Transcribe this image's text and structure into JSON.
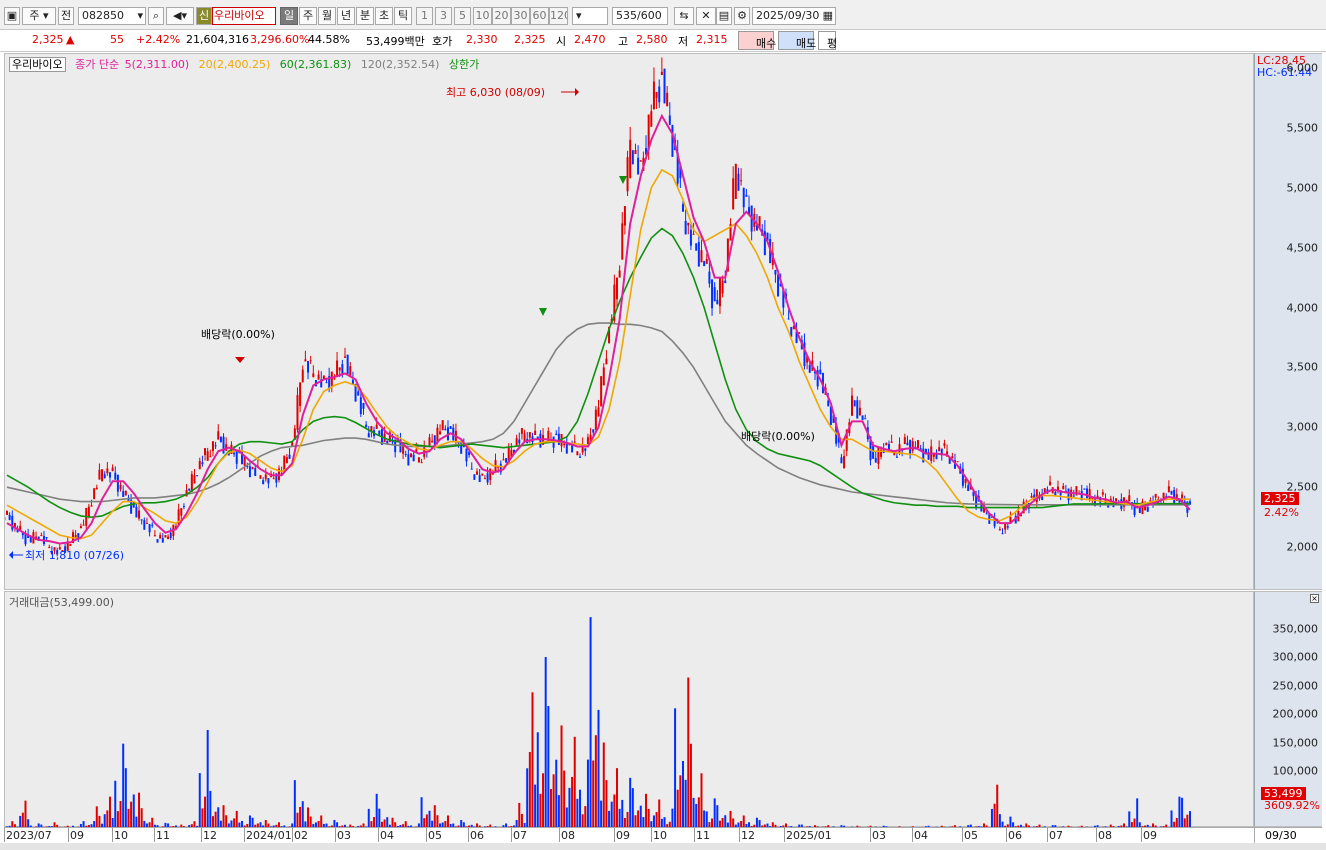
{
  "toolbar": {
    "market": "주",
    "prev": "전",
    "code": "082850",
    "new_badge": "신",
    "stock_name": "우리바이오",
    "periods": [
      "일",
      "주",
      "월",
      "년",
      "분",
      "초",
      "틱"
    ],
    "intervals": [
      "1",
      "3",
      "5",
      "10",
      "20",
      "30",
      "60",
      "120"
    ],
    "count": "535",
    "count_max": "/600",
    "date": "2025/09/30"
  },
  "status": {
    "price": "2,325",
    "arrow": "▲",
    "change": "55",
    "change_pct": "+2.42%",
    "volume": "21,604,316",
    "vol_ratio": "3,296.60%",
    "turnover": "44.58%",
    "amount": "53,499백만",
    "quote_label": "호가",
    "quote_ask": "2,330",
    "quote_bid": "2,325",
    "open_label": "시",
    "open": "2,470",
    "high_label": "고",
    "high": "2,580",
    "low_label": "저",
    "low": "2,315",
    "buy": "매수",
    "sell": "매도",
    "last": "평"
  },
  "price_panel": {
    "legend": {
      "name": "우리바이오",
      "close": "종가 단순",
      "ma5": "5(2,311.00)",
      "ma20": "20(2,400.25)",
      "ma60": "60(2,361.83)",
      "ma120": "120(2,352.54)",
      "limit": "상한가"
    },
    "lc": "LC:28.45",
    "hc": "HC:-61.44",
    "y_ticks": [
      "6,000",
      "5,500",
      "5,000",
      "4,500",
      "4,000",
      "3,500",
      "3,000",
      "2,500",
      "2,000"
    ],
    "current_tag": "2,325",
    "pct_tag": "2.42%",
    "annotations": {
      "high": "최고 6,030 (08/09)",
      "low": "최저 1,810 (07/26)",
      "div1": "배당락(0.00%)",
      "div2": "배당락(0.00%)"
    }
  },
  "volume_panel": {
    "legend": "거래대금(53,499.00)",
    "y_ticks": [
      "350,000",
      "300,000",
      "250,000",
      "200,000",
      "150,000",
      "100,000"
    ],
    "current_tag": "53,499",
    "pct_tag": "3609.92%"
  },
  "x_axis": {
    "labels": [
      "2023/07",
      "09",
      "10",
      "11",
      "12",
      "2024/01",
      "02",
      "03",
      "04",
      "05",
      "06",
      "07",
      "08",
      "09",
      "10",
      "11",
      "12",
      "2025/01",
      "03",
      "04",
      "05",
      "06",
      "07",
      "08",
      "09"
    ],
    "end_label": "09/30"
  },
  "colors": {
    "up": "#e00000",
    "down": "#0030ff",
    "ma5": "#e0209a",
    "ma20": "#f0a800",
    "ma60": "#109010",
    "ma120": "#808080"
  },
  "chart_data": {
    "type": "candlestick",
    "price_y_range": [
      1650,
      6050
    ],
    "x_start_month": "2023/07",
    "closes": [
      2250,
      2150,
      2050,
      2100,
      2000,
      1950,
      2050,
      2150,
      2400,
      2650,
      2600,
      2450,
      2300,
      2200,
      2100,
      2050,
      2200,
      2450,
      2650,
      2800,
      2900,
      2800,
      2750,
      2650,
      2600,
      2550,
      2650,
      2850,
      3550,
      3450,
      3350,
      3450,
      3550,
      3300,
      3000,
      2950,
      2900,
      2850,
      2750,
      2750,
      2850,
      3000,
      2950,
      2850,
      2650,
      2550,
      2650,
      2700,
      2850,
      2950,
      2900,
      2900,
      2900,
      2850,
      2800,
      2850,
      3200,
      3800,
      4400,
      5400,
      5100,
      5700,
      5900,
      5400,
      4800,
      4500,
      4400,
      4000,
      4300,
      5200,
      4800,
      4700,
      4500,
      4200,
      3900,
      3700,
      3500,
      3400,
      3100,
      2700,
      3200,
      3100,
      2700,
      2850,
      2800,
      2850,
      2850,
      2750,
      2800,
      2800,
      2650,
      2500,
      2350,
      2250,
      2150,
      2200,
      2300,
      2400,
      2450,
      2500,
      2450,
      2450,
      2450,
      2400,
      2400,
      2350,
      2400,
      2300,
      2350,
      2400,
      2450,
      2400,
      2325
    ],
    "ma5": [
      2200,
      2150,
      2100,
      2060,
      2050,
      2030,
      2040,
      2080,
      2200,
      2400,
      2550,
      2550,
      2450,
      2320,
      2200,
      2120,
      2150,
      2280,
      2450,
      2650,
      2800,
      2830,
      2800,
      2720,
      2650,
      2600,
      2600,
      2700,
      3100,
      3350,
      3400,
      3420,
      3450,
      3400,
      3200,
      3050,
      2950,
      2900,
      2820,
      2780,
      2800,
      2900,
      2950,
      2900,
      2780,
      2650,
      2620,
      2650,
      2780,
      2880,
      2900,
      2900,
      2890,
      2870,
      2840,
      2840,
      3000,
      3400,
      3900,
      4700,
      5100,
      5400,
      5600,
      5450,
      5100,
      4750,
      4550,
      4250,
      4250,
      4700,
      4800,
      4700,
      4550,
      4300,
      4000,
      3750,
      3550,
      3400,
      3200,
      2850,
      3050,
      3050,
      2850,
      2820,
      2800,
      2820,
      2830,
      2780,
      2780,
      2770,
      2680,
      2550,
      2400,
      2280,
      2200,
      2200,
      2280,
      2370,
      2440,
      2480,
      2460,
      2450,
      2440,
      2410,
      2400,
      2370,
      2380,
      2330,
      2350,
      2380,
      2420,
      2400,
      2311
    ],
    "ma20": [
      2350,
      2300,
      2250,
      2200,
      2150,
      2100,
      2080,
      2070,
      2100,
      2200,
      2300,
      2380,
      2380,
      2330,
      2280,
      2220,
      2200,
      2250,
      2380,
      2540,
      2700,
      2790,
      2810,
      2780,
      2720,
      2660,
      2630,
      2680,
      2900,
      3150,
      3300,
      3350,
      3380,
      3350,
      3250,
      3120,
      3000,
      2920,
      2870,
      2820,
      2810,
      2850,
      2880,
      2880,
      2820,
      2740,
      2680,
      2670,
      2720,
      2800,
      2860,
      2880,
      2880,
      2870,
      2860,
      2850,
      2920,
      3150,
      3550,
      4100,
      4650,
      5000,
      5150,
      5100,
      4900,
      4650,
      4550,
      4600,
      4650,
      4700,
      4600,
      4450,
      4250,
      4000,
      3800,
      3550,
      3350,
      3150,
      3000,
      2900,
      2900,
      2850,
      2800,
      2800,
      2790,
      2780,
      2770,
      2720,
      2640,
      2520,
      2400,
      2300,
      2250,
      2230,
      2220,
      2260,
      2330,
      2400,
      2430,
      2430,
      2420,
      2410,
      2400,
      2390,
      2380,
      2370,
      2360,
      2350,
      2370,
      2390,
      2400,
      2400,
      2400
    ],
    "ma60": [
      2600,
      2550,
      2500,
      2440,
      2380,
      2330,
      2290,
      2260,
      2250,
      2260,
      2300,
      2340,
      2360,
      2370,
      2370,
      2380,
      2400,
      2440,
      2500,
      2580,
      2700,
      2800,
      2860,
      2880,
      2880,
      2870,
      2860,
      2880,
      2980,
      3050,
      3080,
      3090,
      3080,
      3040,
      2990,
      2940,
      2900,
      2880,
      2860,
      2850,
      2840,
      2830,
      2840,
      2850,
      2860,
      2850,
      2840,
      2830,
      2840,
      2850,
      2860,
      2870,
      2880,
      2920,
      3050,
      3280,
      3550,
      3820,
      4050,
      4250,
      4420,
      4580,
      4660,
      4600,
      4450,
      4250,
      4000,
      3700,
      3400,
      3150,
      2980,
      2880,
      2820,
      2780,
      2760,
      2740,
      2720,
      2680,
      2620,
      2560,
      2500,
      2450,
      2420,
      2390,
      2370,
      2360,
      2350,
      2350,
      2340,
      2340,
      2340,
      2330,
      2330,
      2330,
      2330,
      2330,
      2330,
      2330,
      2330,
      2340,
      2350,
      2360,
      2360,
      2360,
      2362,
      2362,
      2362,
      2362,
      2362,
      2362,
      2362,
      2362,
      2362
    ],
    "ma120": [
      2500,
      2480,
      2460,
      2440,
      2420,
      2400,
      2390,
      2380,
      2380,
      2380,
      2390,
      2400,
      2410,
      2410,
      2410,
      2420,
      2430,
      2440,
      2460,
      2490,
      2530,
      2580,
      2640,
      2700,
      2760,
      2800,
      2830,
      2840,
      2850,
      2870,
      2890,
      2900,
      2910,
      2910,
      2900,
      2880,
      2860,
      2850,
      2840,
      2840,
      2840,
      2840,
      2850,
      2860,
      2870,
      2880,
      2900,
      2950,
      3050,
      3200,
      3350,
      3500,
      3650,
      3750,
      3820,
      3860,
      3870,
      3870,
      3860,
      3860,
      3850,
      3830,
      3800,
      3720,
      3620,
      3500,
      3350,
      3200,
      3050,
      2950,
      2850,
      2780,
      2720,
      2660,
      2620,
      2580,
      2550,
      2520,
      2500,
      2480,
      2460,
      2450,
      2440,
      2430,
      2420,
      2410,
      2400,
      2390,
      2380,
      2370,
      2365,
      2360,
      2358,
      2356,
      2355,
      2354,
      2353,
      2353,
      2353,
      2353,
      2353,
      2353,
      2353,
      2353,
      2353,
      2353,
      2353,
      2353,
      2353,
      2353,
      2353,
      2353,
      2353
    ],
    "volume": [
      5,
      12,
      48,
      8,
      6,
      10,
      4,
      7,
      12,
      38,
      55,
      148,
      105,
      62,
      18,
      9,
      8,
      6,
      12,
      172,
      65,
      40,
      30,
      22,
      18,
      14,
      10,
      8,
      84,
      36,
      22,
      14,
      10,
      6,
      8,
      60,
      34,
      18,
      12,
      8,
      54,
      40,
      22,
      14,
      10,
      8,
      6,
      5,
      8,
      44,
      238,
      300,
      214,
      180,
      160,
      120,
      370,
      150,
      105,
      88,
      70,
      60,
      50,
      34,
      210,
      264,
      96,
      52,
      40,
      30,
      22,
      18,
      14,
      10,
      8,
      6,
      6,
      5,
      5,
      5,
      4,
      4,
      4,
      4,
      3,
      3,
      3,
      3,
      4,
      4,
      5,
      5,
      6,
      8,
      76,
      20,
      10,
      8,
      6,
      5,
      5,
      4,
      4,
      4,
      5,
      6,
      8,
      52,
      10,
      8,
      6,
      55,
      53
    ]
  }
}
